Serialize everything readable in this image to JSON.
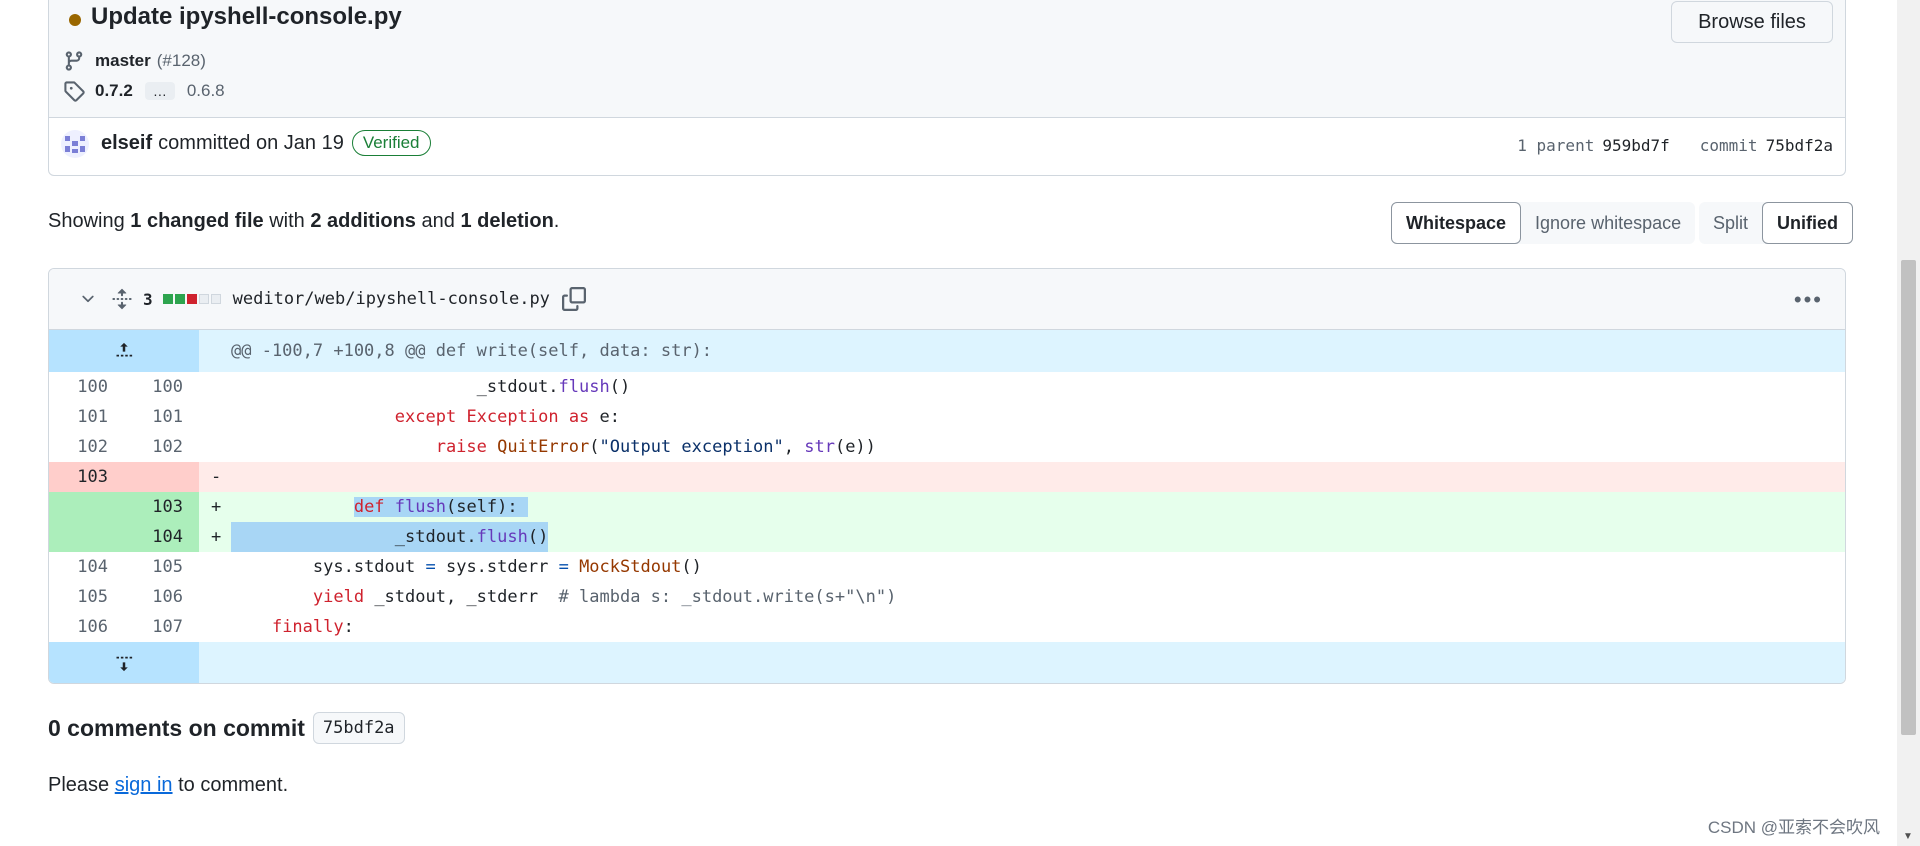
{
  "commit": {
    "title": "Update ipyshell-console.py",
    "browse_label": "Browse files",
    "branch": "master",
    "pr": "(#128)",
    "tag_from": "0.7.2",
    "tag_ellipsis": "…",
    "tag_to": "0.6.8",
    "author": "elseif",
    "committed_text": "committed on Jan 19",
    "verified": "Verified",
    "parent_label": "1 parent",
    "parent_sha": "959bd7f",
    "commit_label": "commit",
    "commit_sha": "75bdf2a"
  },
  "summary": {
    "prefix": "Showing",
    "changed": "1 changed file",
    "with": "with",
    "additions": "2 additions",
    "and": "and",
    "deletions": "1 deletion",
    "period": "."
  },
  "toggles": {
    "whitespace": "Whitespace",
    "ignore_whitespace": "Ignore whitespace",
    "split": "Split",
    "unified": "Unified"
  },
  "file": {
    "change_count": "3",
    "path": "weditor/web/ipyshell-console.py",
    "diffstat": [
      "add",
      "add",
      "del",
      "neutral",
      "neutral"
    ],
    "hunk_header": "@@ -100,7 +100,8 @@ def write(self, data: str):"
  },
  "diff_lines": [
    {
      "old": "100",
      "new": "100",
      "type": "ctx",
      "sign": ""
    },
    {
      "old": "101",
      "new": "101",
      "type": "ctx",
      "sign": ""
    },
    {
      "old": "102",
      "new": "102",
      "type": "ctx",
      "sign": ""
    },
    {
      "old": "103",
      "new": "",
      "type": "del",
      "sign": "-"
    },
    {
      "old": "",
      "new": "103",
      "type": "add",
      "sign": "+"
    },
    {
      "old": "",
      "new": "104",
      "type": "add",
      "sign": "+"
    },
    {
      "old": "104",
      "new": "105",
      "type": "ctx",
      "sign": ""
    },
    {
      "old": "105",
      "new": "106",
      "type": "ctx",
      "sign": ""
    },
    {
      "old": "106",
      "new": "107",
      "type": "ctx",
      "sign": ""
    }
  ],
  "code": {
    "l0": {
      "indent": "                        ",
      "var": "_stdout",
      "dot": ".",
      "fn": "flush",
      "rest": "()"
    },
    "l1": {
      "indent": "                ",
      "kw": "except",
      "sp": " ",
      "cls": "Exception",
      "sp2": " ",
      "kw2": "as",
      "rest": " e:"
    },
    "l2": {
      "indent": "                    ",
      "kw": "raise",
      "sp": " ",
      "cls": "QuitError",
      "p1": "(",
      "str": "\"Output exception\"",
      "comma": ", ",
      "fn": "str",
      "rest": "(e))"
    },
    "l4": {
      "indent": "            ",
      "kw": "def",
      "sp": " ",
      "fn": "flush",
      "rest": "(self):"
    },
    "l5": {
      "indent": "                ",
      "var": "_stdout",
      "dot": ".",
      "fn": "flush",
      "rest": "()"
    },
    "l6": {
      "indent": "        ",
      "a": "sys.stdout ",
      "eq": "=",
      "b": " sys.stderr ",
      "eq2": "=",
      "sp": " ",
      "cls": "MockStdout",
      "rest": "()"
    },
    "l7": {
      "indent": "        ",
      "kw": "yield",
      "rest": " _stdout, _stderr  ",
      "comment": "# lambda s: _stdout.write(s+\"\\n\")"
    },
    "l8": {
      "indent": "    ",
      "kw": "finally",
      "rest": ":"
    }
  },
  "comments": {
    "title": "0 comments on commit",
    "sha": "75bdf2a",
    "please": "Please",
    "sign_in": "sign in",
    "to_comment": "to comment."
  },
  "watermark": "CSDN @亚索不会吹风",
  "colors": {
    "added": "#2da44e",
    "deleted": "#cf222e",
    "verified": "#1a7f37",
    "link": "#0969da"
  }
}
